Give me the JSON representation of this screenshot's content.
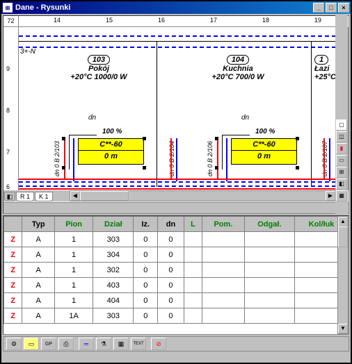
{
  "window": {
    "title": "Dane - Rysunki",
    "corner": "72"
  },
  "ruler_h": [
    "14",
    "15",
    "16",
    "17",
    "18",
    "19"
  ],
  "ruler_v": [
    "9",
    "8",
    "7",
    "6"
  ],
  "origin_label": "3+-N",
  "rooms": [
    {
      "num": "103",
      "name": "Pokój",
      "temp": "+20°C 1000/0 W"
    },
    {
      "num": "104",
      "name": "Kuchnia",
      "temp": "+20°C 700/0 W"
    },
    {
      "num": "1",
      "name": "Łazi",
      "temp": "+25°C"
    }
  ],
  "radiator": {
    "model": "C**-60",
    "len": "0 m",
    "pct": "100 %",
    "dn": "dn"
  },
  "vlabels": [
    "dn 0 B  2/103",
    "dn 0 B  2/104",
    "dn 0 B  2/106",
    "dn 0 B  2/107"
  ],
  "tabs": [
    "R 1",
    "K 1"
  ],
  "grid": {
    "headers": [
      "",
      "Typ",
      "Pion",
      "Dział",
      "Iz.",
      "dn",
      "L",
      "Pom.",
      "Odgał.",
      "Kol/łuk"
    ],
    "rows": [
      [
        "Z",
        "A",
        "1",
        "303",
        "0",
        "0",
        "",
        "",
        "",
        ""
      ],
      [
        "Z",
        "A",
        "1",
        "304",
        "0",
        "0",
        "",
        "",
        "",
        ""
      ],
      [
        "Z",
        "A",
        "1",
        "302",
        "0",
        "0",
        "",
        "",
        "",
        ""
      ],
      [
        "Z",
        "A",
        "1",
        "403",
        "0",
        "0",
        "",
        "",
        "",
        ""
      ],
      [
        "Z",
        "A",
        "1",
        "404",
        "0",
        "0",
        "",
        "",
        "",
        ""
      ],
      [
        "Z",
        "A",
        "1A",
        "303",
        "0",
        "0",
        "",
        "",
        "",
        ""
      ]
    ]
  },
  "bottom_icons": [
    "⚙",
    "▭",
    "GP",
    "⎙",
    "═",
    "⚗",
    "▦",
    "TEXT",
    "⊘"
  ]
}
